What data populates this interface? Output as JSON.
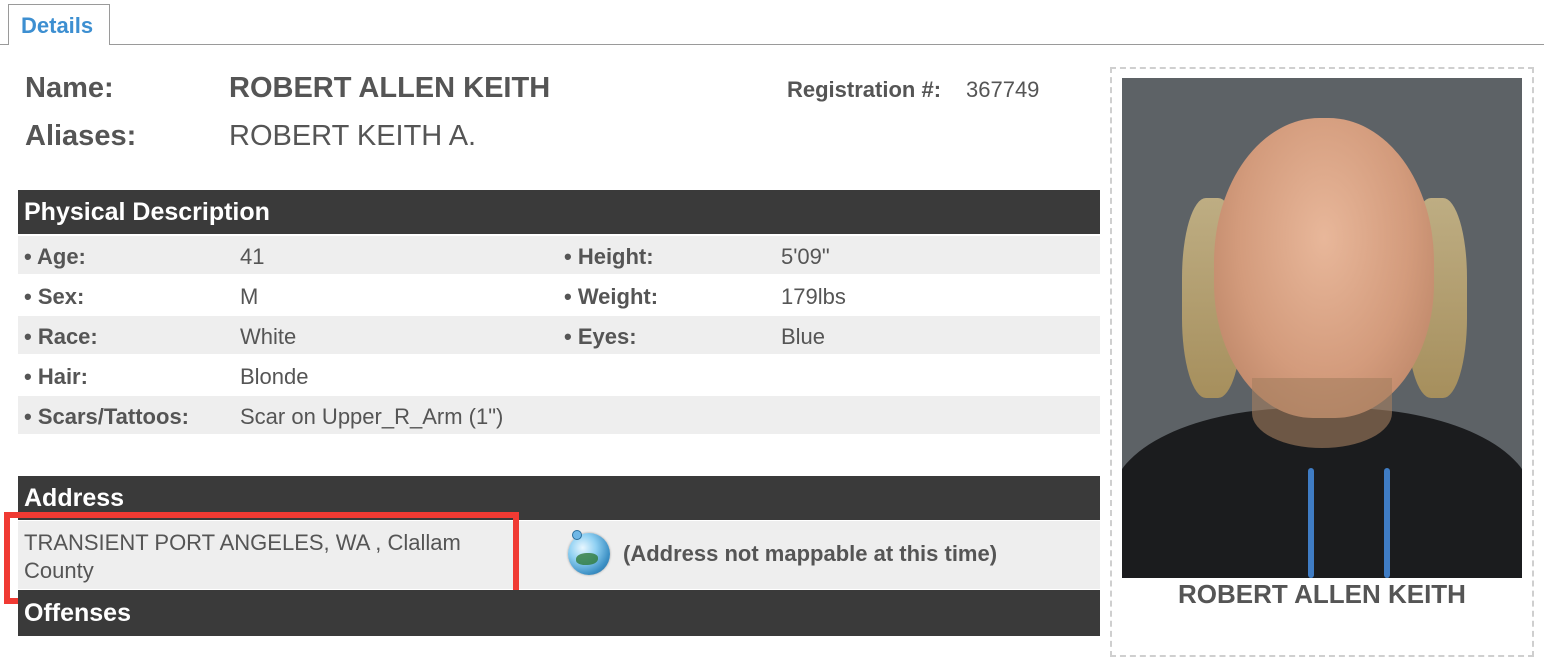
{
  "tabs": {
    "details_label": "Details"
  },
  "offender": {
    "name_label": "Name:",
    "name": "ROBERT ALLEN KEITH",
    "aliases_label": "Aliases:",
    "aliases": "ROBERT KEITH A.",
    "registration_label": "Registration #:",
    "registration_number": "367749"
  },
  "physical": {
    "header": "Physical Description",
    "age_label": "• Age:",
    "age": "41",
    "height_label": "• Height:",
    "height": "5'09\"",
    "sex_label": "• Sex:",
    "sex": "M",
    "weight_label": "• Weight:",
    "weight": "179lbs",
    "race_label": "• Race:",
    "race": "White",
    "eyes_label": "• Eyes:",
    "eyes": "Blue",
    "hair_label": "• Hair:",
    "hair": "Blonde",
    "scars_label": "• Scars/Tattoos:",
    "scars": "Scar on Upper_R_Arm (1\")"
  },
  "address": {
    "header": "Address",
    "text": "TRANSIENT PORT ANGELES, WA , Clallam County",
    "map_note": "(Address not mappable at this time)",
    "highlight_color": "#f03a33"
  },
  "offenses": {
    "header": "Offenses"
  },
  "photo": {
    "caption": "ROBERT ALLEN KEITH"
  },
  "colors": {
    "tab_text": "#3d8fd1",
    "section_bg": "#3a3a3a",
    "row_shade": "#eeeeee"
  }
}
